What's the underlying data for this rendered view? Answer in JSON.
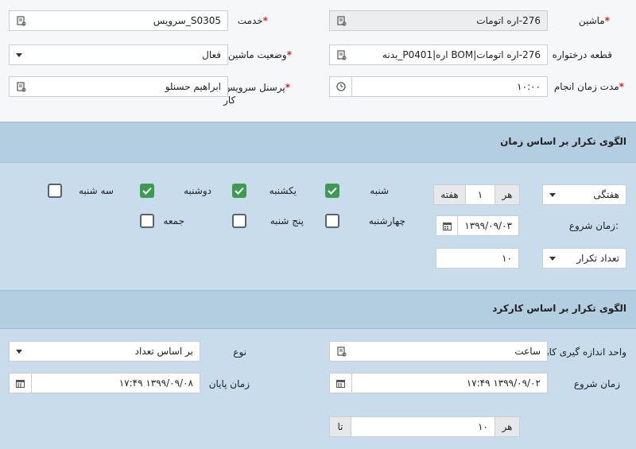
{
  "top": {
    "machine_label": "ماشین",
    "machine_value": "276-اره اتومات",
    "service_label": "خدمت",
    "service_value": "S0305_سرویس",
    "part_label": "قطعه درختواره",
    "part_value": "276-اره اتومات|BOM اره|P0401_بدنه",
    "machine_status_label": "وضعیت ماشین",
    "machine_status_value": "فعال",
    "duration_label": "مدت زمان انجام",
    "duration_value": "۱۰:۰۰",
    "personnel_label_1": "پرسنل سرویس",
    "personnel_label_2": "کار",
    "personnel_value": "ابراهیم حسنلو"
  },
  "time_pattern": {
    "title": "الگوی تکرار بر اساس زمان",
    "frequency_value": "هفتگی",
    "every_label": "هر",
    "every_value": "۱",
    "unit_label": "هفته",
    "start_label": "زمان شروع:",
    "start_value": "۱۳۹۹/۰۹/۰۳",
    "repeat_type_value": "تعداد تکرار",
    "repeat_count_value": "۱۰",
    "days": [
      {
        "label": "شنبه",
        "checked": true
      },
      {
        "label": "یکشنبه",
        "checked": true
      },
      {
        "label": "دوشنبه",
        "checked": true
      },
      {
        "label": "سه شنبه",
        "checked": false
      },
      {
        "label": "چهارشنبه",
        "checked": false
      },
      {
        "label": "پنج شنبه",
        "checked": false
      },
      {
        "label": "جمعه",
        "checked": false
      }
    ]
  },
  "usage_pattern": {
    "title": "الگوی تکرار بر اساس کارکرد",
    "unit_label": "واحد اندازه گیری کارکرد",
    "unit_value": "ساعت",
    "type_label": "نوع",
    "type_value": "بر اساس تعداد",
    "start_label": "زمان شروع",
    "start_value": "۱۳۹۹/۰۹/۰۲ ۱۷:۴۹",
    "end_label": "زمان پایان",
    "end_value": "۱۳۹۹/۰۹/۰۸ ۱۷:۴۹",
    "every_label": "هر",
    "every_value": "۱۰",
    "to_label": "تا"
  },
  "colors": {
    "band": "#b3cde1",
    "panel": "#c8dcec",
    "required": "#d9261c",
    "check": "#3e9a52"
  },
  "icons": {
    "lookup": "lookup-icon",
    "clock": "clock-icon",
    "calendar": "calendar-icon",
    "caret": "chevron-down-icon",
    "check": "check-icon"
  }
}
